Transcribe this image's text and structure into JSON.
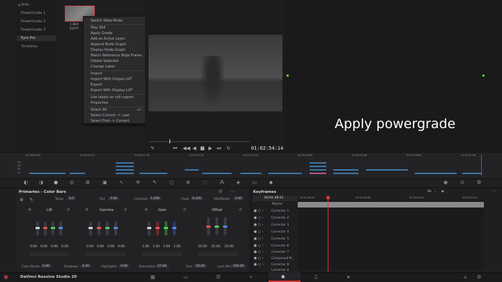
{
  "gallery": {
    "albums": [
      "Stills",
      "PowerGrade 1",
      "PowerGrade 2",
      "PowerGrade 3",
      "Eyre Pro",
      "Timelines"
    ],
    "active": "Eyre Pro",
    "thumb_label_1": "1.38.0",
    "thumb_label_2": "Eyre P"
  },
  "context_menu": {
    "items": [
      {
        "label": "Switch Wipe Mode"
      },
      {
        "label": "Play Still"
      },
      {
        "label": "Apply Grade"
      },
      {
        "label": "Add as Active Layer"
      },
      {
        "label": "Append Node Graph"
      },
      {
        "label": "Display Node Graph"
      },
      {
        "label": "Match Reference Wipe Frame"
      },
      {
        "label": "Delete Selected"
      },
      {
        "label": "Change Label"
      },
      {
        "label": "Import"
      },
      {
        "label": "Import With Output LUT"
      },
      {
        "label": "Export"
      },
      {
        "label": "Export With Display LUT"
      },
      {
        "label": "Use labels on still export"
      },
      {
        "label": "Properties"
      },
      {
        "label": "Select All",
        "shortcut": "⌘A"
      },
      {
        "label": "Select Current -> Last"
      },
      {
        "label": "Select First -> Current"
      }
    ]
  },
  "viewer": {
    "timecode": "01:02:54:14"
  },
  "overlay_title": "Apply powergrade",
  "timeline": {
    "ruler": [
      "01:00:00:00",
      "01:00:20:21",
      "01:00:41:18",
      "01:01:02:15",
      "01:01:23:12",
      "01:01:44:09",
      "01:02:05:06",
      "01:02:26:03",
      "01:02:47:00"
    ],
    "track_labels": [
      "V4",
      "V3",
      "V2",
      "V1"
    ]
  },
  "primaries": {
    "title": "Primaries - Color Bars",
    "top_controls": [
      {
        "label": "Temp",
        "value": "0.0"
      },
      {
        "label": "Tint",
        "value": "0.00"
      },
      {
        "label": "Contrast",
        "value": "1.000"
      },
      {
        "label": "Pivot",
        "value": "0.435"
      },
      {
        "label": "Mid/Detail",
        "value": "0.00"
      }
    ],
    "wheels": [
      {
        "name": "Lift",
        "values": [
          "0.00",
          "0.00",
          "0.00",
          "0.00"
        ]
      },
      {
        "name": "Gamma",
        "values": [
          "0.00",
          "0.00",
          "0.00",
          "0.00"
        ]
      },
      {
        "name": "Gain",
        "values": [
          "1.00",
          "1.00",
          "1.00",
          "1.00"
        ]
      },
      {
        "name": "Offset",
        "values": [
          "25.00",
          "25.00",
          "25.00"
        ]
      }
    ],
    "bottom_controls": [
      {
        "label": "Color Boost",
        "value": "0.00"
      },
      {
        "label": "Shadows",
        "value": "0.00"
      },
      {
        "label": "Highlights",
        "value": "0.00"
      },
      {
        "label": "Saturation",
        "value": "47.60"
      },
      {
        "label": "Hue",
        "value": "50.00"
      },
      {
        "label": "Lum Mix",
        "value": "100.00"
      }
    ]
  },
  "keyframes": {
    "title": "Keyframes",
    "filter": "All",
    "timecode": "00:01:48:22",
    "ruler": [
      "00:01:48:14",
      "00:01:49:06",
      "00:01:49:22",
      "00:01:50:14"
    ],
    "rows": [
      "Master",
      "Corrector 1",
      "Corrector 2",
      "Corrector 3",
      "Corrector 4",
      "Corrector 5",
      "Corrector 6",
      "Corrector 7",
      "Compound N...",
      "Corrector 8",
      "Corrector 9"
    ]
  },
  "status": {
    "app_name": "DaVinci Resolve Studio 20"
  }
}
